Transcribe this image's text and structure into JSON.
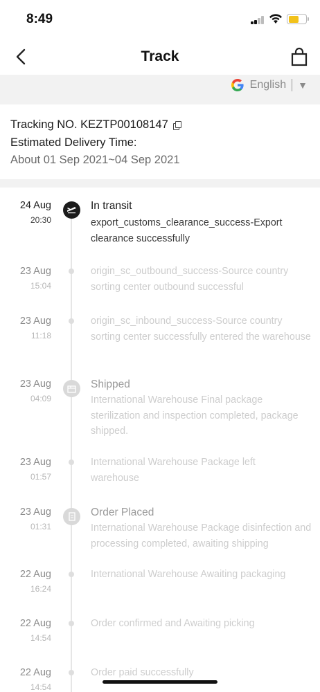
{
  "status_bar": {
    "time": "8:49"
  },
  "nav": {
    "title": "Track"
  },
  "translate": {
    "language": "English",
    "arrow": "▼"
  },
  "tracking": {
    "number_line": "Tracking NO. KEZTP00108147",
    "delivery_label": "Estimated Delivery Time:",
    "delivery_value": "About 01 Sep 2021~04 Sep 2021"
  },
  "events": [
    {
      "date": "24 Aug",
      "time": "20:30",
      "title": "In transit",
      "desc": "export_customs_clearance_success-Export clearance successfully",
      "marker": "plane-icon",
      "active": true
    },
    {
      "date": "23 Aug",
      "time": "15:04",
      "title": "",
      "desc": "origin_sc_outbound_success-Source country sorting center outbound successful",
      "marker": "dot"
    },
    {
      "date": "23 Aug",
      "time": "11:18",
      "title": "",
      "desc": "origin_sc_inbound_success-Source country sorting center successfully entered the warehouse",
      "marker": "dot"
    },
    {
      "date": "23 Aug",
      "time": "04:09",
      "title": "Shipped",
      "desc": "International Warehouse Final package sterilization and inspection completed, package shipped.",
      "marker": "box-icon"
    },
    {
      "date": "23 Aug",
      "time": "01:57",
      "title": "",
      "desc": "International Warehouse Package left warehouse",
      "marker": "dot"
    },
    {
      "date": "23 Aug",
      "time": "01:31",
      "title": "Order Placed",
      "desc": "International Warehouse Package disinfection and processing completed, awaiting shipping",
      "marker": "document-icon"
    },
    {
      "date": "22 Aug",
      "time": "16:24",
      "title": "",
      "desc": "International Warehouse Awaiting packaging",
      "marker": "dot"
    },
    {
      "date": "22 Aug",
      "time": "14:54",
      "title": "",
      "desc": "Order confirmed and Awaiting picking",
      "marker": "dot"
    },
    {
      "date": "22 Aug",
      "time": "14:54",
      "title": "",
      "desc": "Order paid successfully",
      "marker": "dot"
    }
  ]
}
